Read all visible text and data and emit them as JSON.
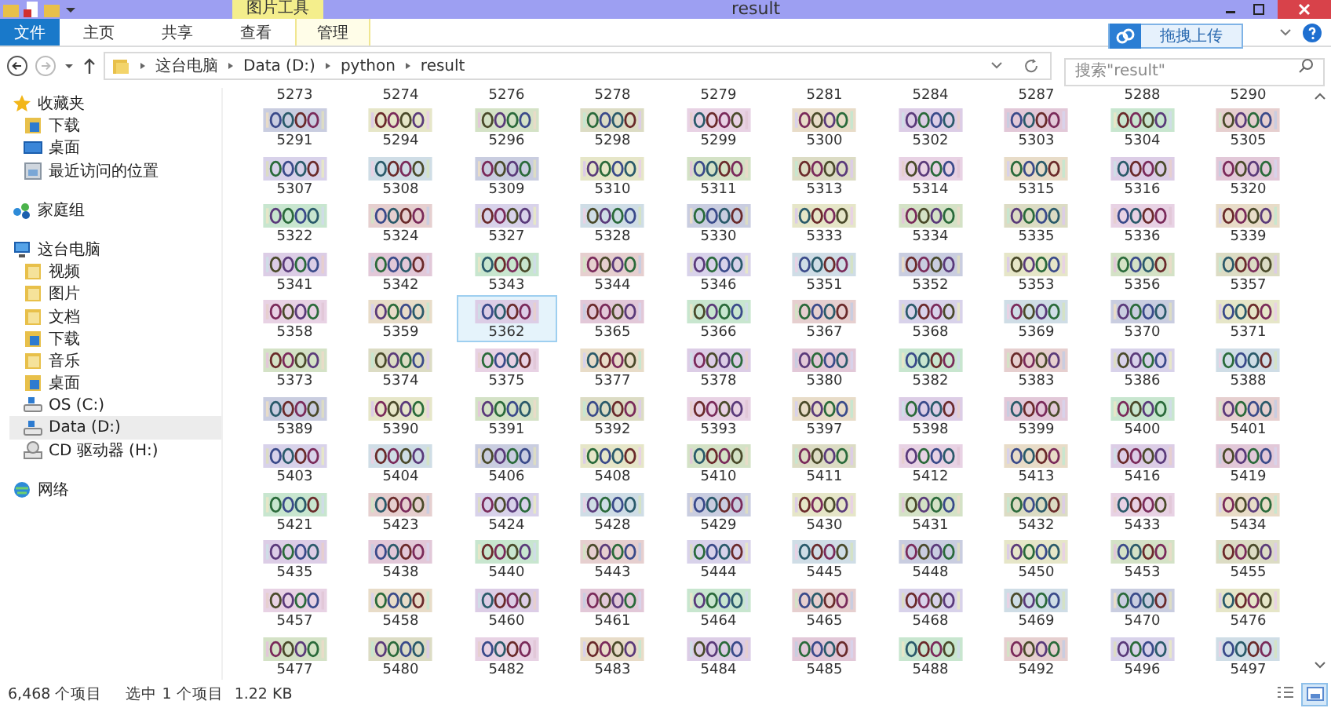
{
  "window": {
    "title": "result",
    "context_tab": "图片工具"
  },
  "ribbon": {
    "tabs": [
      {
        "label": "文件",
        "kind": "file",
        "selected": false
      },
      {
        "label": "主页",
        "kind": "tab",
        "selected": false
      },
      {
        "label": "共享",
        "kind": "tab",
        "selected": false
      },
      {
        "label": "查看",
        "kind": "tab",
        "selected": false
      },
      {
        "label": "管理",
        "kind": "context",
        "selected": false
      }
    ],
    "upload_button": "拖拽上传"
  },
  "address": {
    "crumbs": [
      "这台电脑",
      "Data (D:)",
      "python",
      "result"
    ],
    "search": {
      "placeholder": "搜索\"result\""
    }
  },
  "sidebar": {
    "groups": [
      {
        "label": "收藏夹",
        "kind": "favorites",
        "selected": false,
        "children": [
          {
            "label": "下载",
            "kind": "download",
            "selected": false
          },
          {
            "label": "桌面",
            "kind": "desktop",
            "selected": false
          },
          {
            "label": "最近访问的位置",
            "kind": "recent",
            "selected": false
          }
        ]
      },
      {
        "label": "家庭组",
        "kind": "homegroup",
        "selected": false
      },
      {
        "label": "这台电脑",
        "kind": "computer",
        "selected": false,
        "children": [
          {
            "label": "视频",
            "kind": "folder",
            "selected": false
          },
          {
            "label": "图片",
            "kind": "folder",
            "selected": false
          },
          {
            "label": "文档",
            "kind": "folder",
            "selected": false
          },
          {
            "label": "下载",
            "kind": "download",
            "selected": false
          },
          {
            "label": "音乐",
            "kind": "folder",
            "selected": false
          },
          {
            "label": "桌面",
            "kind": "download",
            "selected": false
          },
          {
            "label": "OS (C:)",
            "kind": "drive",
            "selected": false
          },
          {
            "label": "Data (D:)",
            "kind": "drive",
            "selected": true
          },
          {
            "label": "CD 驱动器 (H:)",
            "kind": "cd",
            "selected": false
          }
        ]
      },
      {
        "label": "网络",
        "kind": "network",
        "selected": false
      }
    ]
  },
  "files": {
    "clipped_row": [
      "5273",
      "5274",
      "5276",
      "5278",
      "5279",
      "5281",
      "5284",
      "5287",
      "5288",
      "5290"
    ],
    "items": [
      {
        "name": "5291",
        "selected": false
      },
      {
        "name": "5294",
        "selected": false
      },
      {
        "name": "5296",
        "selected": false
      },
      {
        "name": "5298",
        "selected": false
      },
      {
        "name": "5299",
        "selected": false
      },
      {
        "name": "5300",
        "selected": false
      },
      {
        "name": "5302",
        "selected": false
      },
      {
        "name": "5303",
        "selected": false
      },
      {
        "name": "5304",
        "selected": false
      },
      {
        "name": "5305",
        "selected": false
      },
      {
        "name": "5307",
        "selected": false
      },
      {
        "name": "5308",
        "selected": false
      },
      {
        "name": "5309",
        "selected": false
      },
      {
        "name": "5310",
        "selected": false
      },
      {
        "name": "5311",
        "selected": false
      },
      {
        "name": "5313",
        "selected": false
      },
      {
        "name": "5314",
        "selected": false
      },
      {
        "name": "5315",
        "selected": false
      },
      {
        "name": "5316",
        "selected": false
      },
      {
        "name": "5320",
        "selected": false
      },
      {
        "name": "5322",
        "selected": false
      },
      {
        "name": "5324",
        "selected": false
      },
      {
        "name": "5327",
        "selected": false
      },
      {
        "name": "5328",
        "selected": false
      },
      {
        "name": "5330",
        "selected": false
      },
      {
        "name": "5333",
        "selected": false
      },
      {
        "name": "5334",
        "selected": false
      },
      {
        "name": "5335",
        "selected": false
      },
      {
        "name": "5336",
        "selected": false
      },
      {
        "name": "5339",
        "selected": false
      },
      {
        "name": "5341",
        "selected": false
      },
      {
        "name": "5342",
        "selected": false
      },
      {
        "name": "5343",
        "selected": false
      },
      {
        "name": "5344",
        "selected": false
      },
      {
        "name": "5346",
        "selected": false
      },
      {
        "name": "5351",
        "selected": false
      },
      {
        "name": "5352",
        "selected": false
      },
      {
        "name": "5353",
        "selected": false
      },
      {
        "name": "5356",
        "selected": false
      },
      {
        "name": "5357",
        "selected": false
      },
      {
        "name": "5358",
        "selected": false
      },
      {
        "name": "5359",
        "selected": false
      },
      {
        "name": "5362",
        "selected": true
      },
      {
        "name": "5365",
        "selected": false
      },
      {
        "name": "5366",
        "selected": false
      },
      {
        "name": "5367",
        "selected": false
      },
      {
        "name": "5368",
        "selected": false
      },
      {
        "name": "5369",
        "selected": false
      },
      {
        "name": "5370",
        "selected": false
      },
      {
        "name": "5371",
        "selected": false
      },
      {
        "name": "5373",
        "selected": false
      },
      {
        "name": "5374",
        "selected": false
      },
      {
        "name": "5375",
        "selected": false
      },
      {
        "name": "5377",
        "selected": false
      },
      {
        "name": "5378",
        "selected": false
      },
      {
        "name": "5380",
        "selected": false
      },
      {
        "name": "5382",
        "selected": false
      },
      {
        "name": "5383",
        "selected": false
      },
      {
        "name": "5386",
        "selected": false
      },
      {
        "name": "5388",
        "selected": false
      },
      {
        "name": "5389",
        "selected": false
      },
      {
        "name": "5390",
        "selected": false
      },
      {
        "name": "5391",
        "selected": false
      },
      {
        "name": "5392",
        "selected": false
      },
      {
        "name": "5393",
        "selected": false
      },
      {
        "name": "5397",
        "selected": false
      },
      {
        "name": "5398",
        "selected": false
      },
      {
        "name": "5399",
        "selected": false
      },
      {
        "name": "5400",
        "selected": false
      },
      {
        "name": "5401",
        "selected": false
      },
      {
        "name": "5403",
        "selected": false
      },
      {
        "name": "5404",
        "selected": false
      },
      {
        "name": "5406",
        "selected": false
      },
      {
        "name": "5408",
        "selected": false
      },
      {
        "name": "5410",
        "selected": false
      },
      {
        "name": "5411",
        "selected": false
      },
      {
        "name": "5412",
        "selected": false
      },
      {
        "name": "5413",
        "selected": false
      },
      {
        "name": "5416",
        "selected": false
      },
      {
        "name": "5419",
        "selected": false
      },
      {
        "name": "5421",
        "selected": false
      },
      {
        "name": "5423",
        "selected": false
      },
      {
        "name": "5424",
        "selected": false
      },
      {
        "name": "5428",
        "selected": false
      },
      {
        "name": "5429",
        "selected": false
      },
      {
        "name": "5430",
        "selected": false
      },
      {
        "name": "5431",
        "selected": false
      },
      {
        "name": "5432",
        "selected": false
      },
      {
        "name": "5433",
        "selected": false
      },
      {
        "name": "5434",
        "selected": false
      },
      {
        "name": "5435",
        "selected": false
      },
      {
        "name": "5438",
        "selected": false
      },
      {
        "name": "5440",
        "selected": false
      },
      {
        "name": "5443",
        "selected": false
      },
      {
        "name": "5444",
        "selected": false
      },
      {
        "name": "5445",
        "selected": false
      },
      {
        "name": "5448",
        "selected": false
      },
      {
        "name": "5450",
        "selected": false
      },
      {
        "name": "5453",
        "selected": false
      },
      {
        "name": "5455",
        "selected": false
      },
      {
        "name": "5457",
        "selected": false
      },
      {
        "name": "5458",
        "selected": false
      },
      {
        "name": "5460",
        "selected": false
      },
      {
        "name": "5461",
        "selected": false
      },
      {
        "name": "5464",
        "selected": false
      },
      {
        "name": "5465",
        "selected": false
      },
      {
        "name": "5468",
        "selected": false
      },
      {
        "name": "5469",
        "selected": false
      },
      {
        "name": "5470",
        "selected": false
      },
      {
        "name": "5476",
        "selected": false
      },
      {
        "name": "5477",
        "selected": false
      },
      {
        "name": "5480",
        "selected": false
      },
      {
        "name": "5482",
        "selected": false
      },
      {
        "name": "5483",
        "selected": false
      },
      {
        "name": "5484",
        "selected": false
      },
      {
        "name": "5485",
        "selected": false
      },
      {
        "name": "5488",
        "selected": false
      },
      {
        "name": "5492",
        "selected": false
      },
      {
        "name": "5496",
        "selected": false
      },
      {
        "name": "5497",
        "selected": false
      }
    ]
  },
  "status_bar": {
    "count": "6,468 个项目",
    "selection": "选中 1 个项目",
    "size": "1.22 KB",
    "views": [
      {
        "kind": "details",
        "selected": false
      },
      {
        "kind": "large_icons",
        "selected": true
      }
    ]
  }
}
